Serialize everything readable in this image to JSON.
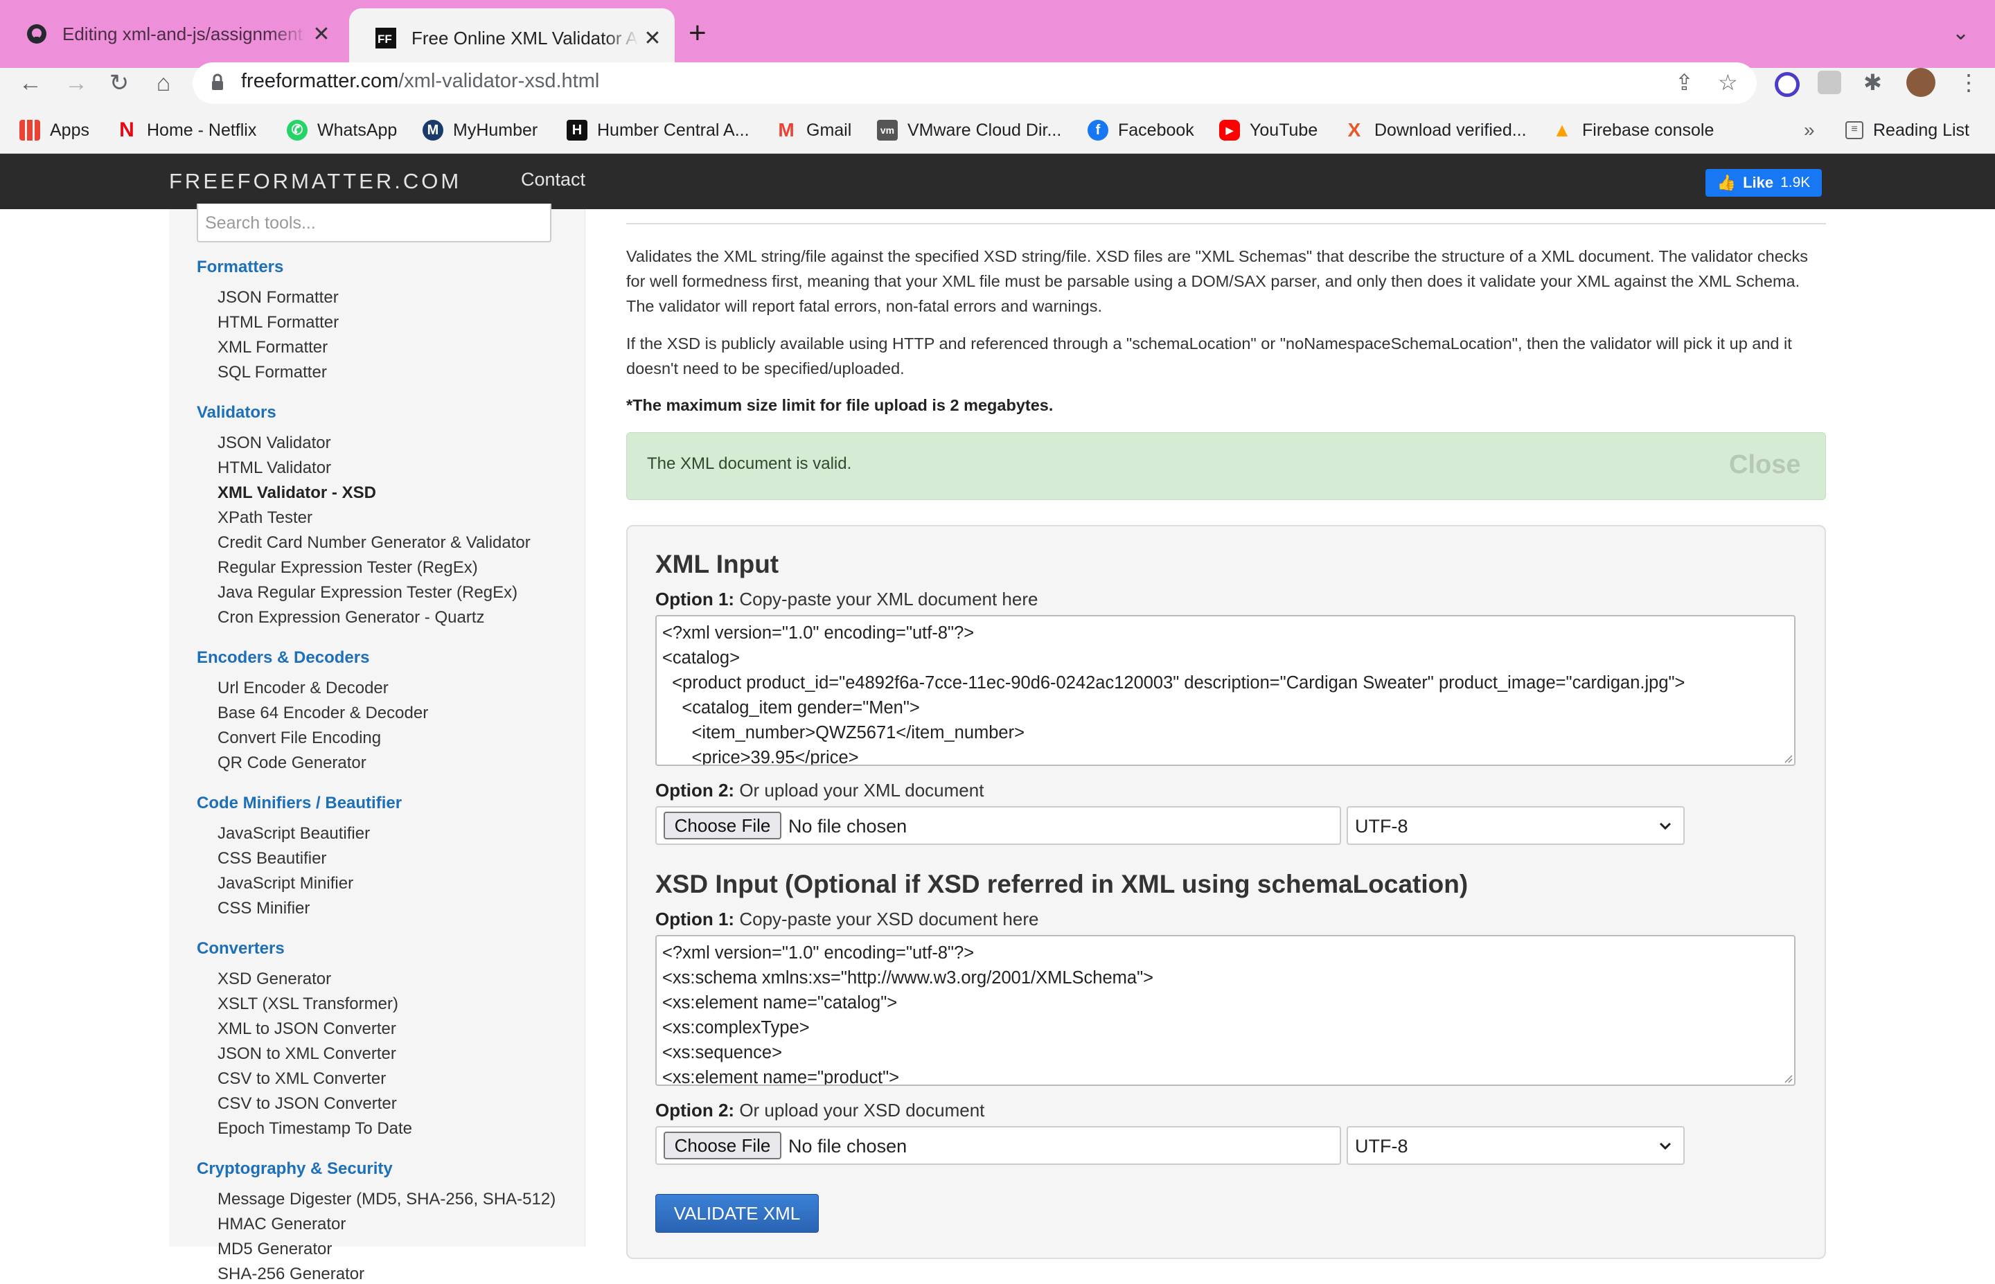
{
  "browser": {
    "tabs": [
      {
        "title": "Editing xml-and-js/assignment",
        "icon": "github-icon",
        "active": false
      },
      {
        "title": "Free Online XML Validator Against XSD",
        "icon": "freeformatter-icon",
        "active": true
      }
    ],
    "url_host": "freeformatter.com",
    "url_path": "/xml-validator-xsd.html",
    "bookmarks": [
      {
        "label": "Apps",
        "icon": "apps-grid-icon"
      },
      {
        "label": "Home - Netflix",
        "icon": "netflix-icon"
      },
      {
        "label": "WhatsApp",
        "icon": "whatsapp-icon"
      },
      {
        "label": "MyHumber",
        "icon": "myhumber-icon"
      },
      {
        "label": "Humber Central A...",
        "icon": "humber-icon"
      },
      {
        "label": "Gmail",
        "icon": "gmail-icon"
      },
      {
        "label": "VMware Cloud Dir...",
        "icon": "vmware-icon"
      },
      {
        "label": "Facebook",
        "icon": "facebook-icon"
      },
      {
        "label": "YouTube",
        "icon": "youtube-icon"
      },
      {
        "label": "Download verified...",
        "icon": "download-verified-icon"
      },
      {
        "label": "Firebase console",
        "icon": "firebase-icon"
      }
    ],
    "overflow_label": "»",
    "reading_list": "Reading List",
    "colors": {
      "tabstrip": "#ee8fd9",
      "toolbar": "#f3f3f3"
    }
  },
  "site": {
    "brand": "FREEFORMATTER.COM",
    "contact": "Contact",
    "like_label": "Like",
    "like_count": "1.9K",
    "header_color": "#2b2b2b"
  },
  "sidebar": {
    "search_placeholder": "Search tools...",
    "sections": [
      {
        "title": "Formatters",
        "items": [
          "JSON Formatter",
          "HTML Formatter",
          "XML Formatter",
          "SQL Formatter"
        ]
      },
      {
        "title": "Validators",
        "items": [
          "JSON Validator",
          "HTML Validator",
          "XML Validator - XSD",
          "XPath Tester",
          "Credit Card Number Generator & Validator",
          "Regular Expression Tester (RegEx)",
          "Java Regular Expression Tester (RegEx)",
          "Cron Expression Generator - Quartz"
        ]
      },
      {
        "title": "Encoders & Decoders",
        "items": [
          "Url Encoder & Decoder",
          "Base 64 Encoder & Decoder",
          "Convert File Encoding",
          "QR Code Generator"
        ]
      },
      {
        "title": "Code Minifiers / Beautifier",
        "items": [
          "JavaScript Beautifier",
          "CSS Beautifier",
          "JavaScript Minifier",
          "CSS Minifier"
        ]
      },
      {
        "title": "Converters",
        "items": [
          "XSD Generator",
          "XSLT (XSL Transformer)",
          "XML to JSON Converter",
          "JSON to XML Converter",
          "CSV to XML Converter",
          "CSV to JSON Converter",
          "Epoch Timestamp To Date"
        ]
      },
      {
        "title": "Cryptography & Security",
        "items": [
          "Message Digester (MD5, SHA-256, SHA-512)",
          "HMAC Generator",
          "MD5 Generator",
          "SHA-256 Generator"
        ]
      }
    ],
    "active_item": "XML Validator - XSD"
  },
  "main": {
    "intro": "Validates the XML string/file against the specified XSD string/file. XSD files are \"XML Schemas\" that describe the structure of a XML document. The validator checks for well formedness first, meaning that your XML file must be parsable using a DOM/SAX parser, and only then does it validate your XML against the XML Schema. The validator will report fatal errors, non-fatal errors and warnings.",
    "schema_note": "If the XSD is publicly available using HTTP and referenced through a \"schemaLocation\" or \"noNamespaceSchemaLocation\", then the validator will pick it up and it doesn't need to be specified/uploaded.",
    "limit_note": "*The maximum size limit for file upload is 2 megabytes.",
    "alert": {
      "text": "The XML document is valid.",
      "close": "Close",
      "color": "#d6ebd4"
    },
    "xml_input": {
      "heading": "XML Input",
      "opt1_bold": "Option 1:",
      "opt1_text": "Copy-paste your XML document here",
      "lines": [
        "<?xml version=\"1.0\" encoding=\"utf-8\"?>",
        "<catalog>",
        "  <product product_id=\"e4892f6a-7cce-11ec-90d6-0242ac120003\" description=\"Cardigan Sweater\" product_image=\"cardigan.jpg\">",
        "    <catalog_item gender=\"Men\">",
        "      <item_number>QWZ5671</item_number>",
        "      <price>39.95</price>"
      ],
      "opt2_bold": "Option 2:",
      "opt2_text": "Or upload your XML document",
      "choose": "Choose File",
      "nofile": "No file chosen",
      "encoding": "UTF-8"
    },
    "xsd_input": {
      "heading": "XSD Input (Optional if XSD referred in XML using schemaLocation)",
      "opt1_bold": "Option 1:",
      "opt1_text": "Copy-paste your XSD document here",
      "lines": [
        "<?xml version=\"1.0\" encoding=\"utf-8\"?>",
        "<xs:schema xmlns:xs=\"http://www.w3.org/2001/XMLSchema\">",
        "<xs:element name=\"catalog\">",
        "<xs:complexType>",
        "<xs:sequence>",
        "<xs:element name=\"product\">"
      ],
      "opt2_bold": "Option 2:",
      "opt2_text": "Or upload your XSD document",
      "choose": "Choose File",
      "nofile": "No file chosen",
      "encoding": "UTF-8"
    },
    "validate_button": "VALIDATE XML"
  }
}
